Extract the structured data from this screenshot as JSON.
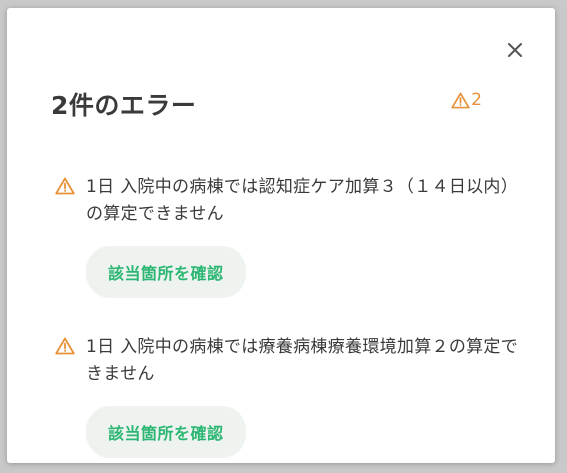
{
  "dialog": {
    "title": "2件のエラー",
    "count": "2",
    "close_icon": "close-icon"
  },
  "colors": {
    "warning": "#e8913a",
    "action_text": "#2bb673",
    "action_bg": "#eff3ef"
  },
  "errors": [
    {
      "icon": "warning-icon",
      "message": "1日 入院中の病棟では認知症ケア加算３（１４日以内）の算定できません",
      "action_label": "該当箇所を確認"
    },
    {
      "icon": "warning-icon",
      "message": "1日 入院中の病棟では療養病棟療養環境加算２の算定できません",
      "action_label": "該当箇所を確認"
    }
  ]
}
